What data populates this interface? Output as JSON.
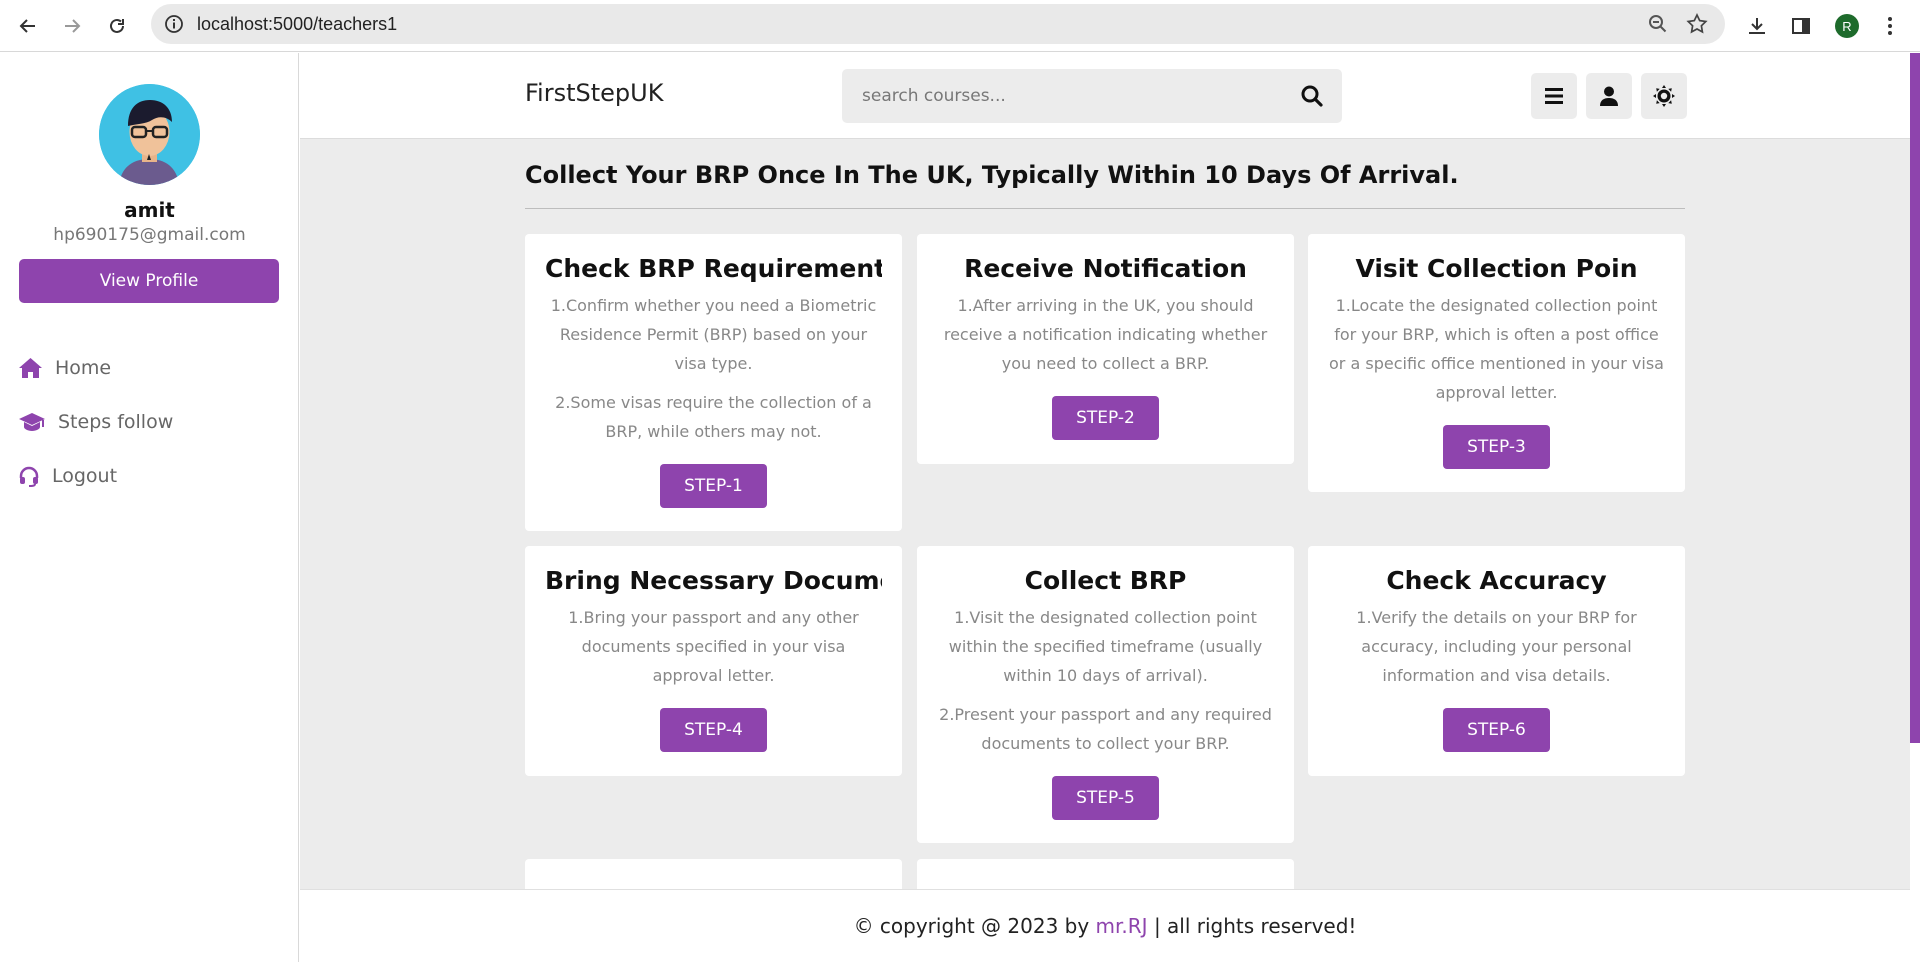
{
  "browser": {
    "url": "localhost:5000/teachers1",
    "profile_initial": "R"
  },
  "sidebar": {
    "name": "amit",
    "email": "hp690175@gmail.com",
    "view_profile": "View Profile",
    "items": [
      {
        "label": "Home",
        "icon": "home-icon"
      },
      {
        "label": "Steps follow",
        "icon": "graduation-cap-icon"
      },
      {
        "label": "Logout",
        "icon": "headset-icon"
      }
    ]
  },
  "header": {
    "brand": "FirstStepUK",
    "search_placeholder": "search courses..."
  },
  "main": {
    "title": "Collect Your BRP Once In The UK, Typically Within 10 Days Of Arrival.",
    "cards": [
      {
        "title": "Check BRP Requirement",
        "paragraphs": [
          "1.Confirm whether you need a Biometric Residence Permit (BRP) based on your visa type.",
          "2.Some visas require the collection of a BRP, while others may not."
        ],
        "button": "STEP-1"
      },
      {
        "title": "Receive Notification",
        "paragraphs": [
          "1.After arriving in the UK, you should receive a notification indicating whether you need to collect a BRP."
        ],
        "button": "STEP-2"
      },
      {
        "title": "Visit Collection Poin",
        "paragraphs": [
          "1.Locate the designated collection point for your BRP, which is often a post office or a specific office mentioned in your visa approval letter."
        ],
        "button": "STEP-3"
      },
      {
        "title": "Bring Necessary Documents",
        "paragraphs": [
          "1.Bring your passport and any other documents specified in your visa approval letter."
        ],
        "button": "STEP-4"
      },
      {
        "title": "Collect BRP",
        "paragraphs": [
          "1.Visit the designated collection point within the specified timeframe (usually within 10 days of arrival).",
          "2.Present your passport and any required documents to collect your BRP."
        ],
        "button": "STEP-5"
      },
      {
        "title": "Check Accuracy",
        "paragraphs": [
          "1.Verify the details on your BRP for accuracy, including your personal information and visa details."
        ],
        "button": "STEP-6"
      }
    ]
  },
  "footer": {
    "prefix": "© copyright @ 2023 by",
    "author": "mr.RJ",
    "suffix": "| all rights reserved!"
  },
  "colors": {
    "accent": "#8e44ad",
    "background": "#ececec"
  }
}
